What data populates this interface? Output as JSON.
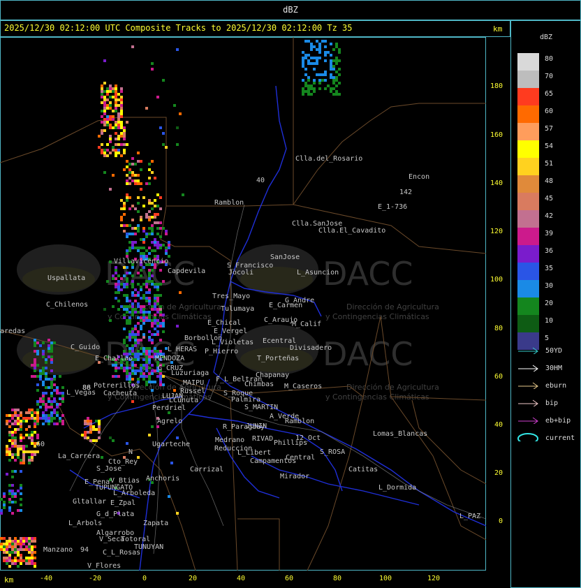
{
  "window_title": "dBZ",
  "header": {
    "text": "2025/12/30 02:12:00 UTC Composite Tracks to 2025/12/30 02:12:00 Tz 35",
    "unit": "km"
  },
  "axes": {
    "x_unit": "km",
    "x_ticks": [
      "-40",
      "-20",
      "0",
      "20",
      "40",
      "60",
      "80",
      "100",
      "120"
    ],
    "y_ticks": [
      "180",
      "160",
      "140",
      "120",
      "100",
      "80",
      "60",
      "40",
      "20",
      "0"
    ]
  },
  "legend": {
    "title": "dBZ",
    "levels": [
      {
        "label": "80",
        "color": "#d9d9d9"
      },
      {
        "label": "70",
        "color": "#bdbdbd"
      },
      {
        "label": "65",
        "color": "#ff3b1f"
      },
      {
        "label": "60",
        "color": "#ff6a00"
      },
      {
        "label": "57",
        "color": "#ff9d5c"
      },
      {
        "label": "54",
        "color": "#ffff00"
      },
      {
        "label": "51",
        "color": "#ffd21f"
      },
      {
        "label": "48",
        "color": "#e08a3a"
      },
      {
        "label": "45",
        "color": "#d97b5f"
      },
      {
        "label": "42",
        "color": "#c27090"
      },
      {
        "label": "39",
        "color": "#cc1a8c"
      },
      {
        "label": "36",
        "color": "#7a1ccc"
      },
      {
        "label": "35",
        "color": "#2a55e6"
      },
      {
        "label": "30",
        "color": "#1a8ae6"
      },
      {
        "label": "20",
        "color": "#14861e"
      },
      {
        "label": "10",
        "color": "#0e5c14"
      },
      {
        "label": "5",
        "color": "#3a3a8a"
      }
    ]
  },
  "tracks": [
    {
      "label": "50YD",
      "color": "#33cccc",
      "icon": "arrow-right-icon"
    },
    {
      "label": "30HM",
      "color": "#ffffff",
      "icon": "arrow-right-icon"
    },
    {
      "label": "eburn",
      "color": "#e6c88a",
      "icon": "arrow-right-icon"
    },
    {
      "label": "bip",
      "color": "#f0c8c8",
      "icon": "arrow-right-icon"
    },
    {
      "label": "eb+bip",
      "color": "#d040d0",
      "icon": "arrow-right-icon"
    },
    {
      "label": "current",
      "color": "#33e6e6",
      "icon": "ellipse-icon"
    }
  ],
  "watermark": {
    "brand": "DACC",
    "line1": "Dirección de Agricultura",
    "line2": "y Contingencias Climáticas"
  },
  "places": [
    {
      "name": "Clla.del_Rosario"
    },
    {
      "name": "Encon"
    },
    {
      "name": "142"
    },
    {
      "name": "E_1-736"
    },
    {
      "name": "Ramblon"
    },
    {
      "name": "Clla.SanJose"
    },
    {
      "name": "Clla.El_Cavadito"
    },
    {
      "name": "Villavicencio"
    },
    {
      "name": "S_Francisco"
    },
    {
      "name": "SanJose"
    },
    {
      "name": "Uspallata"
    },
    {
      "name": "Capdevila"
    },
    {
      "name": "Jocoli"
    },
    {
      "name": "L_Asuncion"
    },
    {
      "name": "Tres_Mayo"
    },
    {
      "name": "G_Andre"
    },
    {
      "name": "C_Chilenos"
    },
    {
      "name": "Tulumaya"
    },
    {
      "name": "E_Carmen"
    },
    {
      "name": "C_Araujo"
    },
    {
      "name": "M_Calif"
    },
    {
      "name": "E_Chical"
    },
    {
      "name": "E_Vergel"
    },
    {
      "name": "aredas"
    },
    {
      "name": "Borbollon"
    },
    {
      "name": "L_Violetas"
    },
    {
      "name": "Ecentral"
    },
    {
      "name": "Divisadero"
    },
    {
      "name": "C_Guido"
    },
    {
      "name": "L_HERAS"
    },
    {
      "name": "P_Hierro"
    },
    {
      "name": "E_Challao"
    },
    {
      "name": "MENDOZA"
    },
    {
      "name": "T_Porteñas"
    },
    {
      "name": "G_CRUZ"
    },
    {
      "name": "Luzuriaga"
    },
    {
      "name": "Chapanay"
    },
    {
      "name": "F_L_Beltran"
    },
    {
      "name": "MAIPU"
    },
    {
      "name": "Russel"
    },
    {
      "name": "Chimbas"
    },
    {
      "name": "M_Caseros"
    },
    {
      "name": "Potrerillos"
    },
    {
      "name": "L_Vegas"
    },
    {
      "name": "Cacheuta"
    },
    {
      "name": "LUJAN"
    },
    {
      "name": "S_Roque"
    },
    {
      "name": "LCunuta"
    },
    {
      "name": "Palmira"
    },
    {
      "name": "Perdriel"
    },
    {
      "name": "S_MARTIN"
    },
    {
      "name": "A_Verde"
    },
    {
      "name": "Agrelo"
    },
    {
      "name": "Ramblon"
    },
    {
      "name": "R_Paraguay"
    },
    {
      "name": "JUNIN"
    },
    {
      "name": "Lomas_Blancas"
    },
    {
      "name": "Ugarteche"
    },
    {
      "name": "12_Oct"
    },
    {
      "name": "Medrano"
    },
    {
      "name": "RIVAD"
    },
    {
      "name": "Phillips"
    },
    {
      "name": "Reduccion"
    },
    {
      "name": "S_ROSA"
    },
    {
      "name": "La_Carrera"
    },
    {
      "name": "L_Libert"
    },
    {
      "name": "Cto_Rey"
    },
    {
      "name": "Campamentos"
    },
    {
      "name": "Central"
    },
    {
      "name": "Catitas"
    },
    {
      "name": "S_Jose"
    },
    {
      "name": "Carrizal"
    },
    {
      "name": "Anchoris"
    },
    {
      "name": "E_Pena"
    },
    {
      "name": "V_Btias"
    },
    {
      "name": "Mirador"
    },
    {
      "name": "TUPUNGATO"
    },
    {
      "name": "L_Dormida"
    },
    {
      "name": "L_Arboleda"
    },
    {
      "name": "Gltallar"
    },
    {
      "name": "E_Zpal"
    },
    {
      "name": "G_d_Plata"
    },
    {
      "name": "L_Arbols"
    },
    {
      "name": "Zapata"
    },
    {
      "name": "L_PAZ"
    },
    {
      "name": "Algarrobo"
    },
    {
      "name": "V_Seca"
    },
    {
      "name": "Totoral"
    },
    {
      "name": "TUNUYAN"
    },
    {
      "name": "Manzano"
    },
    {
      "name": "C_L_Rosas"
    },
    {
      "name": "94"
    },
    {
      "name": "V_Flores"
    },
    {
      "name": "86"
    },
    {
      "name": "40"
    },
    {
      "name": "60"
    },
    {
      "name": "N"
    },
    {
      "name": "88"
    }
  ]
}
